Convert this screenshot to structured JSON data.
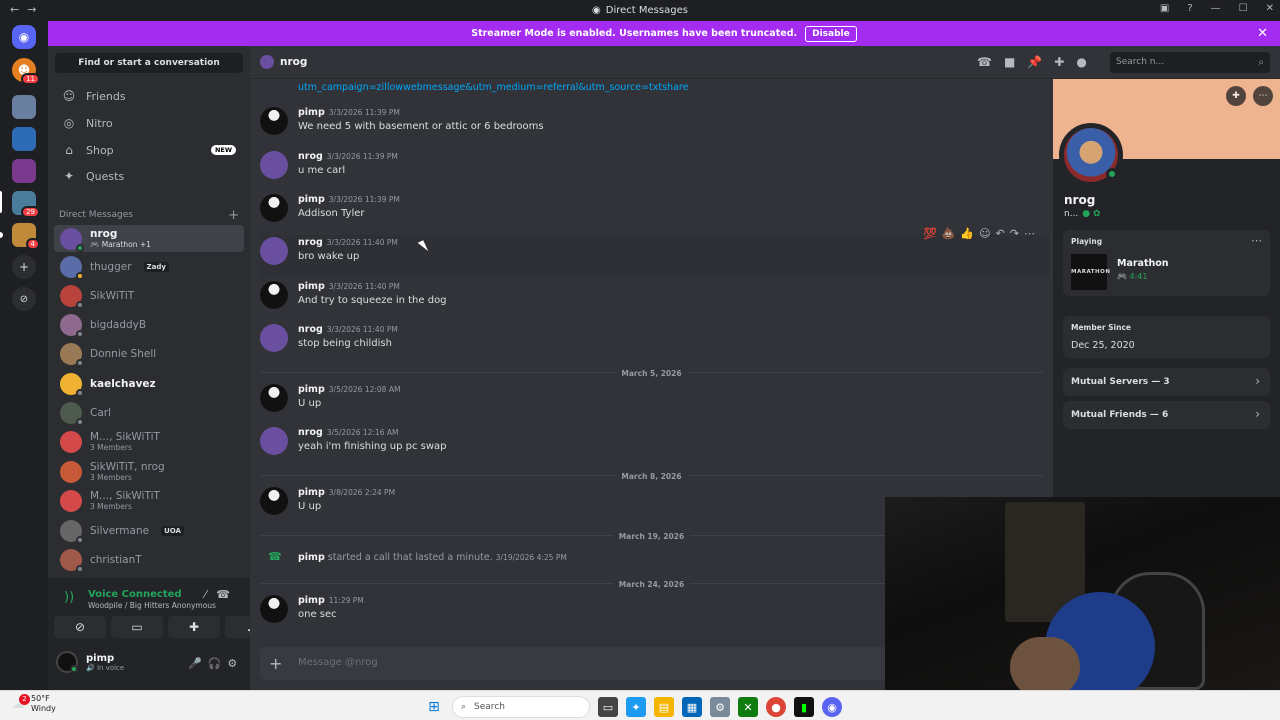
{
  "window": {
    "title": "Direct Messages"
  },
  "banner": {
    "text": "Streamer Mode is enabled. Usernames have been truncated.",
    "button": "Disable"
  },
  "server_badges": {
    "s1": "11",
    "s5": "29",
    "s6": "4"
  },
  "dm_panel": {
    "find_button": "Find or start a conversation",
    "nav": [
      {
        "label": "Friends",
        "icon": "friends-icon"
      },
      {
        "label": "Nitro",
        "icon": "nitro-icon"
      },
      {
        "label": "Shop",
        "icon": "shop-icon",
        "badge": "NEW"
      },
      {
        "label": "Quests",
        "icon": "quests-icon"
      }
    ],
    "header": "Direct Messages",
    "dms": [
      {
        "name": "nrog",
        "sub": "Marathon +1",
        "color": "#6a4fa0"
      },
      {
        "name": "thugger",
        "tag": "Zady",
        "color": "#5b6da8"
      },
      {
        "name": "SikWiTiT",
        "color": "#b8423c"
      },
      {
        "name": "bigdaddyB",
        "color": "#8e6a8f"
      },
      {
        "name": "Donnie Shell",
        "color": "#9a7a56"
      },
      {
        "name": "kaelchavez",
        "color": "#f0b232"
      },
      {
        "name": "Carl",
        "color": "#4d5a4d"
      },
      {
        "name": "M..., SikWiTiT",
        "sub": "3 Members",
        "color": "#d44a4a"
      },
      {
        "name": "SikWiTiT, nrog",
        "sub": "3 Members",
        "color": "#c85a3a"
      },
      {
        "name": "M..., SikWiTiT",
        "sub": "3 Members",
        "color": "#d44a4a"
      },
      {
        "name": "Silvermane",
        "tag": "UOA",
        "color": "#666"
      },
      {
        "name": "christianT",
        "color": "#a05a4a"
      }
    ]
  },
  "voice": {
    "status": "Voice Connected",
    "server": "Woodpile / Big Hitters Anonymous"
  },
  "user": {
    "name": "pimp",
    "status": "In voice"
  },
  "chat": {
    "channel": "nrog",
    "search_placeholder": "Search n...",
    "link": "utm_campaign=zillowwebmessage&utm_medium=referral&utm_source=txtshare",
    "messages": [
      {
        "author": "pimp",
        "time": "3/3/2026 11:39 PM",
        "text": "We need 5 with basement or attic or 6 bedrooms"
      },
      {
        "author": "nrog",
        "time": "3/3/2026 11:39 PM",
        "text": "u me carl"
      },
      {
        "author": "pimp",
        "time": "3/3/2026 11:39 PM",
        "text": "Addison Tyler"
      },
      {
        "author": "nrog",
        "time": "3/3/2026 11:40 PM",
        "text": "bro wake up"
      },
      {
        "author": "pimp",
        "time": "3/3/2026 11:40 PM",
        "text": "And try to squeeze in the dog"
      },
      {
        "author": "nrog",
        "time": "3/3/2026 11:40 PM",
        "text": "stop being childish"
      },
      {
        "author": "pimp",
        "time": "3/5/2026 12:08 AM",
        "text": "U up"
      },
      {
        "author": "nrog",
        "time": "3/5/2026 12:16 AM",
        "text": "yeah i'm finishing up pc swap"
      },
      {
        "author": "pimp",
        "time": "3/8/2026 2:24 PM",
        "text": "U up"
      },
      {
        "author": "pimp",
        "time": "11:29 PM",
        "text": "one sec"
      }
    ],
    "separators": [
      "March 5, 2026",
      "March 8, 2026",
      "March 19, 2026",
      "March 24, 2026"
    ],
    "call": {
      "author": "pimp",
      "text": "started a call that lasted a minute.",
      "time": "3/19/2026 4:25 PM"
    },
    "composer_placeholder": "Message @nrog"
  },
  "profile": {
    "name": "nrog",
    "nick": "n...",
    "playing_label": "Playing",
    "game": "Marathon",
    "game_logo": "MARATHON",
    "game_time": "4:41",
    "member_since_label": "Member Since",
    "member_since": "Dec 25, 2020",
    "mutual_servers": "Mutual Servers — 3",
    "mutual_friends": "Mutual Friends — 6"
  },
  "taskbar": {
    "weather_temp": "50°F",
    "weather_desc": "Windy",
    "weather_badge": "2",
    "search": "Search"
  },
  "colors": {
    "accent": "#a42bf0",
    "online": "#23a55a",
    "link": "#00a8fc"
  }
}
